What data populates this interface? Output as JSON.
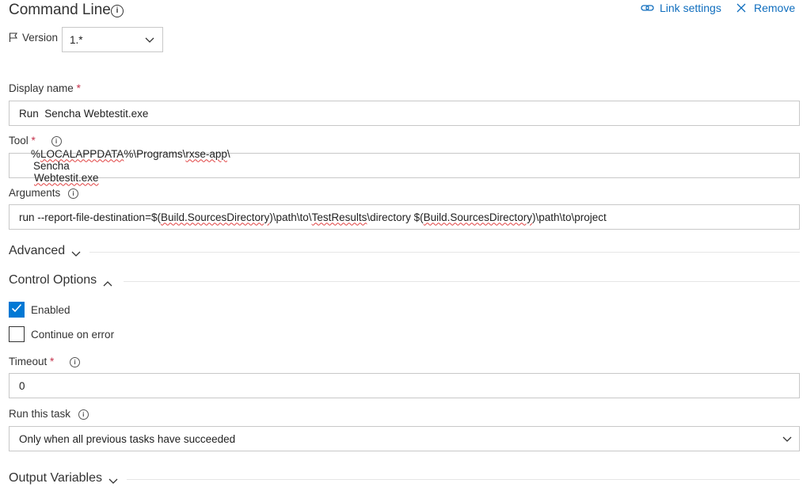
{
  "header": {
    "title": "Command Line",
    "link_settings": "Link settings",
    "remove": "Remove"
  },
  "version": {
    "label": "Version",
    "value": "1.*"
  },
  "display_name": {
    "label": "Display name",
    "required": "*",
    "value": "Run  Sencha Webtestit.exe"
  },
  "tool": {
    "label": "Tool",
    "required": "*",
    "value_part1": "%",
    "value_part2": "LOCALAPPDATA",
    "value_part3": "%\\Programs\\",
    "value_part4": "rxse-app",
    "value_part5": "\\",
    "value_part6": "Sencha",
    "value_part7": "Webtestit.exe"
  },
  "arguments": {
    "label": "Arguments",
    "p1": "run --report-file-destination=$(",
    "p2": "Build.SourcesDirectory",
    "p3": ")\\path\\to\\",
    "p4": "TestResults",
    "p5": "\\directory $(",
    "p6": "Build.SourcesDirectory",
    "p7": ")\\path\\to\\project"
  },
  "advanced": {
    "label": "Advanced"
  },
  "control_options": {
    "label": "Control Options",
    "enabled_label": "Enabled",
    "enabled_checked": true,
    "continue_label": "Continue on error",
    "continue_checked": false
  },
  "timeout": {
    "label": "Timeout",
    "required": "*",
    "value": "0"
  },
  "run_this_task": {
    "label": "Run this task",
    "value": "Only when all previous tasks have succeeded"
  },
  "output_variables": {
    "label": "Output Variables"
  },
  "colors": {
    "accent": "#0078d4",
    "link": "#106ebe",
    "required": "#c4314b"
  },
  "icons": [
    "info-icon",
    "link-icon",
    "close-icon",
    "flag-icon",
    "chevron-down-icon",
    "chevron-up-icon",
    "checkmark-icon"
  ]
}
